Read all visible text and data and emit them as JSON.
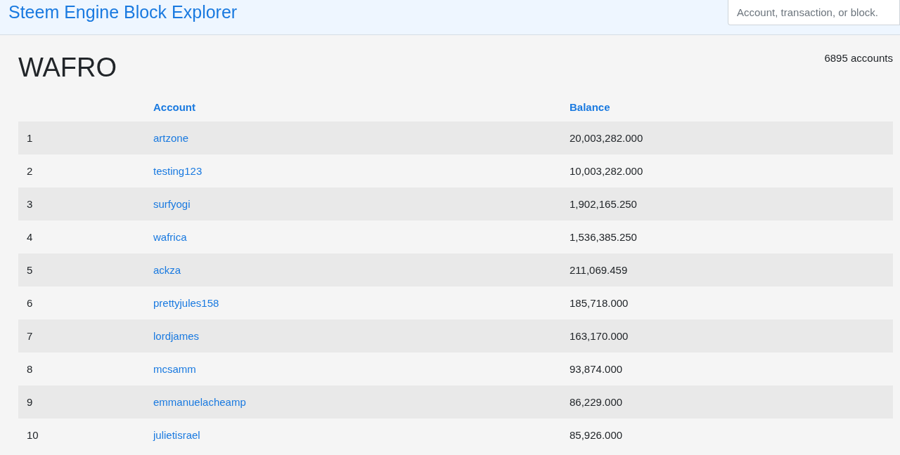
{
  "header": {
    "title": "Steem Engine Block Explorer",
    "search": {
      "placeholder": "Account, transaction, or block."
    }
  },
  "token": {
    "symbol": "WAFRO",
    "account_count": "6895 accounts"
  },
  "table": {
    "columns": [
      "Account",
      "Balance"
    ],
    "rows": [
      {
        "rank": "1",
        "account": "artzone",
        "balance": "20,003,282.000"
      },
      {
        "rank": "2",
        "account": "testing123",
        "balance": "10,003,282.000"
      },
      {
        "rank": "3",
        "account": "surfyogi",
        "balance": "1,902,165.250"
      },
      {
        "rank": "4",
        "account": "wafrica",
        "balance": "1,536,385.250"
      },
      {
        "rank": "5",
        "account": "ackza",
        "balance": "211,069.459"
      },
      {
        "rank": "6",
        "account": "prettyjules158",
        "balance": "185,718.000"
      },
      {
        "rank": "7",
        "account": "lordjames",
        "balance": "163,170.000"
      },
      {
        "rank": "8",
        "account": "mcsamm",
        "balance": "93,874.000"
      },
      {
        "rank": "9",
        "account": "emmanuelacheamp",
        "balance": "86,229.000"
      },
      {
        "rank": "10",
        "account": "julietisrael",
        "balance": "85,926.000"
      }
    ]
  }
}
